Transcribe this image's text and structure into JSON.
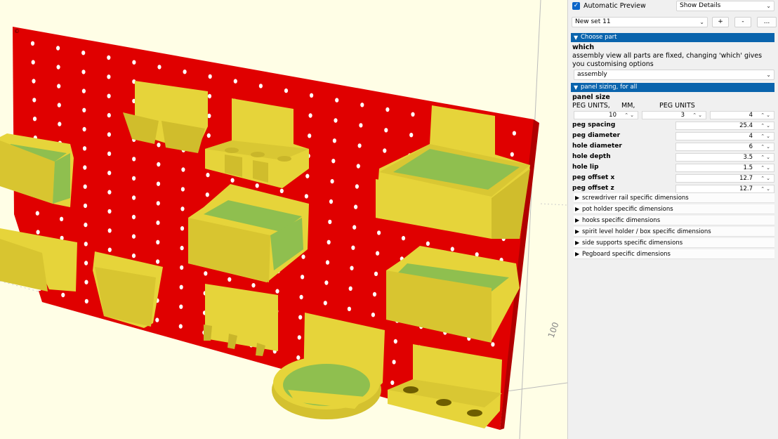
{
  "toolbar": {
    "auto_preview_label": "Automatic Preview",
    "show_details": "Show Details",
    "preset": "New set 11",
    "add_label": "+",
    "remove_label": "-",
    "more_label": "..."
  },
  "section_choose": "Choose part",
  "which": {
    "name": "which",
    "description": "assembly view all parts are fixed, changing 'which' gives you customising options",
    "value": "assembly"
  },
  "section_sizing": "panel sizing, for all",
  "panel_size": {
    "name": "panel size",
    "col_labels": [
      "PEG UNITS,",
      "MM,",
      "PEG UNITS"
    ],
    "values": [
      "10",
      "3",
      "4"
    ]
  },
  "params": [
    {
      "name": "peg spacing",
      "value": "25.4"
    },
    {
      "name": "peg diameter",
      "value": "4"
    },
    {
      "name": "hole diameter",
      "value": "6"
    },
    {
      "name": "hole depth",
      "value": "3.5"
    },
    {
      "name": "hole lip",
      "value": "1.5"
    },
    {
      "name": "peg offset x",
      "value": "12.7"
    },
    {
      "name": "peg offset z",
      "value": "12.7"
    }
  ],
  "subsections": [
    "screwdriver rail specific dimensions",
    "pot holder specific dimensions",
    "hooks specific dimensions",
    "spirit level holder / box specific dimensions",
    "side supports specific dimensions",
    "Pegboard specific dimensions"
  ],
  "viewport": {
    "axis_label_1": "100",
    "axis_label_2": "100",
    "colors": {
      "board": "#e00000",
      "part": "#e6d43a",
      "part_inner": "#8fbf4f",
      "background": "#fffee6"
    }
  }
}
